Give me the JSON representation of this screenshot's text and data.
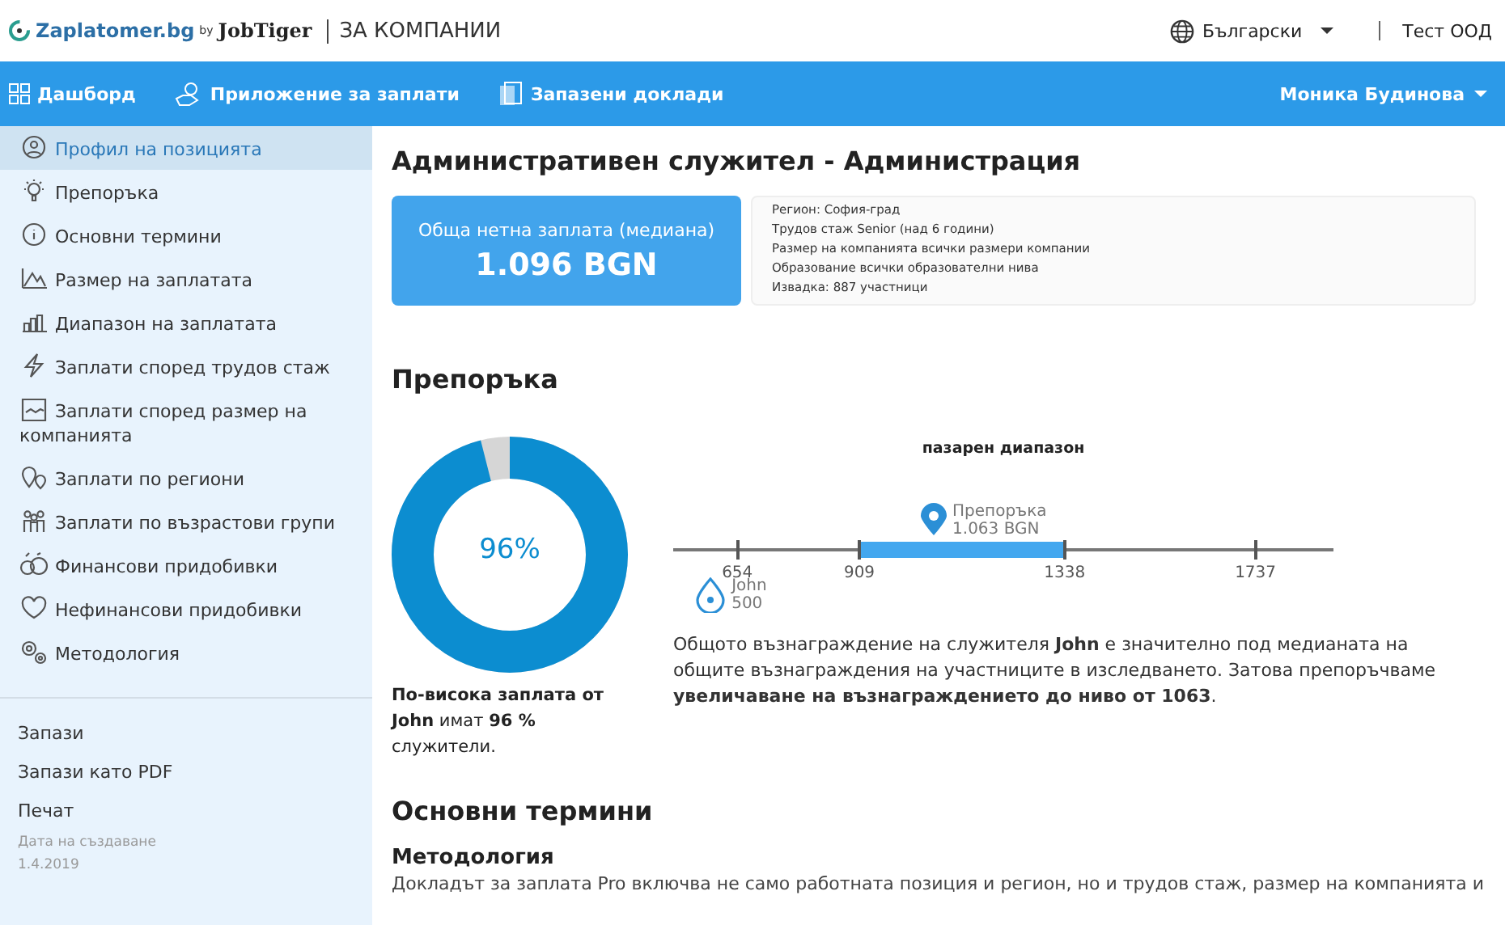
{
  "header": {
    "logo_text": "Zaplatomer.bg",
    "logo_by": "by",
    "logo_brand": "JobTiger",
    "section": "ЗА КОМПАНИИ",
    "language": "Български",
    "company": "Тест ООД"
  },
  "nav": {
    "items": [
      {
        "label": "Дашборд"
      },
      {
        "label": "Приложение за заплати"
      },
      {
        "label": "Запазени доклади"
      }
    ],
    "user": "Моника Будинова"
  },
  "sidebar": {
    "items": [
      {
        "label": "Профил на позицията",
        "selected": true
      },
      {
        "label": "Препоръка",
        "selected": false
      },
      {
        "label": "Основни термини",
        "selected": false
      },
      {
        "label": "Размер на заплатата",
        "selected": false
      },
      {
        "label": "Диапазон на заплатата",
        "selected": false
      },
      {
        "label": "Заплати според трудов стаж",
        "selected": false
      },
      {
        "label": "Заплати според размер на компанията",
        "selected": false
      },
      {
        "label": "Заплати по региони",
        "selected": false
      },
      {
        "label": "Заплати по възрастови групи",
        "selected": false
      },
      {
        "label": "Финансови придобивки",
        "selected": false
      },
      {
        "label": "Нефинансови придобивки",
        "selected": false
      },
      {
        "label": "Методология",
        "selected": false
      }
    ],
    "actions": [
      "Запази",
      "Запази като PDF",
      "Печат"
    ],
    "created_label": "Дата на създаване",
    "created_date": "1.4.2019"
  },
  "page_title": "Административен служител - Администрация",
  "salary_card": {
    "label": "Обща нетна заплата (медиана)",
    "value": "1.096 BGN"
  },
  "filters": [
    "Регион: София-град",
    "Трудов стаж Senior (над 6 години)",
    "Размер на компанията всички размери компании",
    "Образование всички образователни нива",
    "Извадка: 887 участници"
  ],
  "recommendation": {
    "heading": "Препоръка",
    "donut": {
      "level": 0.96,
      "label": "96%"
    },
    "donut_caption": "**По-висока заплата от John** имат **96 %** служители.",
    "range": {
      "title": "пазарен диапазон",
      "ticks": [
        "654",
        "909",
        "1338",
        "1737"
      ],
      "recommendation_label": "Препоръка",
      "recommendation_value": "1.063 BGN",
      "employee_label": "John",
      "employee_value": "500"
    },
    "text": "Общото възнаграждение на служителя **John** е значително под медианата на общите възнаграждения на участниците в изследването. Затова препоръчваме **увеличаване на възнаграждението до ниво от 1063**."
  },
  "basic_terms": {
    "heading": "Основни термини",
    "subheading": "Методология",
    "text": "Докладът за заплата Pro включва не само работната позиция и регион, но и трудов стаж, размер на компанията и"
  }
}
